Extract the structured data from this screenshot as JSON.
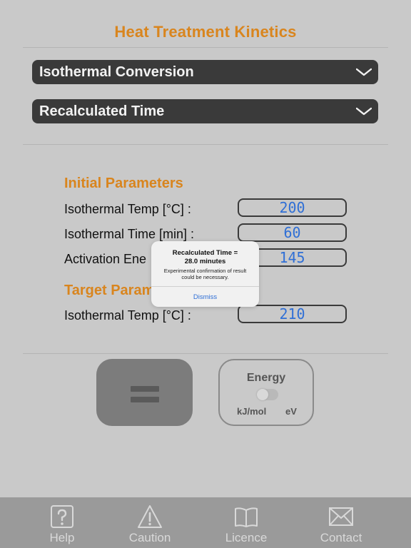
{
  "app": {
    "title": "Heat Treatment Kinetics"
  },
  "dropdowns": [
    {
      "label": "Isothermal Conversion"
    },
    {
      "label": "Recalculated Time"
    }
  ],
  "initial": {
    "title": "Initial Parameters",
    "rows": [
      {
        "label": "Isothermal Temp [°C] :",
        "value": "200"
      },
      {
        "label": "Isothermal Time [min] :",
        "value": "60"
      },
      {
        "label": "Activation Ene",
        "value": "145"
      }
    ]
  },
  "target": {
    "title": "Target Param",
    "rows": [
      {
        "label": "Isothermal Temp [°C] :",
        "value": "210"
      }
    ]
  },
  "energy": {
    "title": "Energy",
    "left": "kJ/mol",
    "right": "eV",
    "on": false
  },
  "alert": {
    "title_line1": "Recalculated Time =",
    "title_line2": "28.0 minutes",
    "message_line1": "Experimental confirmation of result",
    "message_line2": "could be necessary.",
    "dismiss": "Dismiss"
  },
  "tabs": [
    {
      "label": "Help",
      "icon": "help-icon"
    },
    {
      "label": "Caution",
      "icon": "caution-icon"
    },
    {
      "label": "Licence",
      "icon": "book-icon"
    },
    {
      "label": "Contact",
      "icon": "mail-icon"
    }
  ],
  "colors": {
    "accent": "#d9851e",
    "value": "#2f6fd6",
    "dropdown": "#3a3a3a",
    "background": "#c9c9c9",
    "tabbar": "#9a9a9a"
  }
}
